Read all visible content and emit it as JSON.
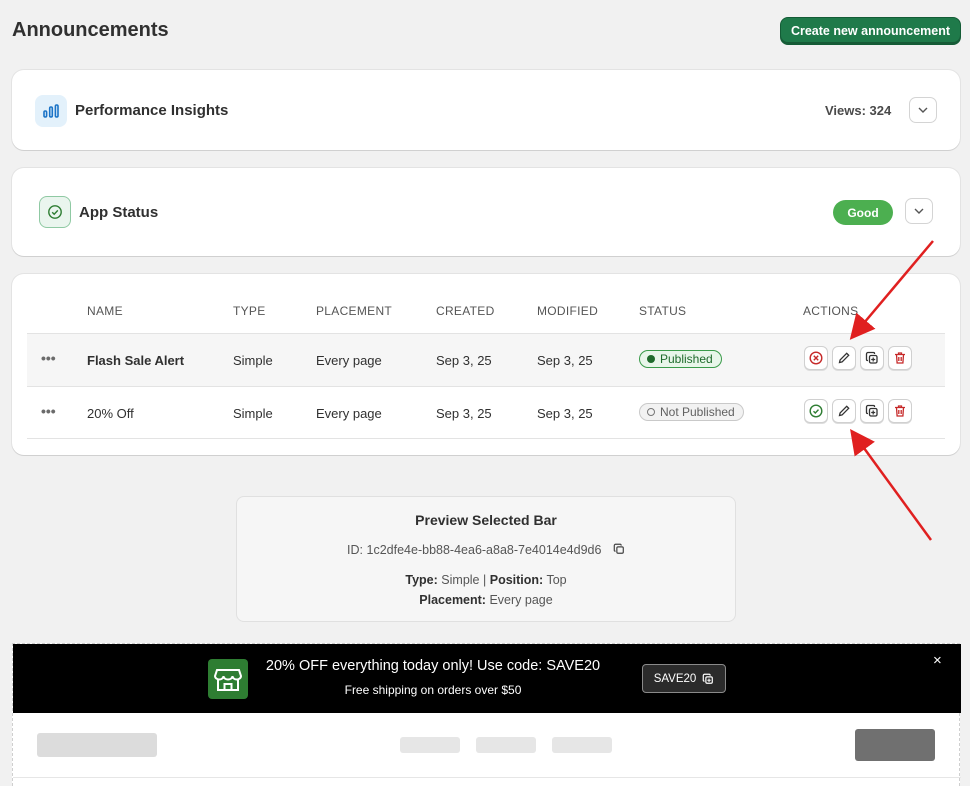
{
  "page": {
    "title": "Announcements",
    "create_label": "Create new announcement"
  },
  "performance": {
    "title": "Performance Insights",
    "views": "Views: 324"
  },
  "app_status": {
    "title": "App Status",
    "badge": "Good",
    "badge_color": "#4caf50"
  },
  "table": {
    "headers": [
      "NAME",
      "TYPE",
      "PLACEMENT",
      "CREATED",
      "MODIFIED",
      "STATUS",
      "ACTIONS"
    ],
    "rows": [
      {
        "name": "Flash Sale Alert",
        "type": "Simple",
        "placement": "Every page",
        "created": "Sep 3, 25",
        "modified": "Sep 3, 25",
        "status": "Published"
      },
      {
        "name": "20% Off",
        "type": "Simple",
        "placement": "Every page",
        "created": "Sep 3, 25",
        "modified": "Sep 3, 25",
        "status": "Not Published"
      }
    ]
  },
  "preview": {
    "title": "Preview Selected Bar",
    "id_label": "ID:",
    "id_value": "1c2dfe4e-bb88-4ea6-a8a8-7e4014e4d9d6",
    "type_label": "Type:",
    "type_value": "Simple",
    "separator": "|",
    "position_label": "Position:",
    "position_value": "Top",
    "placement_label": "Placement:",
    "placement_value": "Every page"
  },
  "announcement_bar": {
    "message": "20% OFF everything today only! Use code: SAVE20",
    "subtext": "Free shipping on orders over $50",
    "code": "SAVE20",
    "close": "×"
  },
  "colors": {
    "accent": "#1f7a4a",
    "published": "#3a9b4a",
    "delete": "#c62828"
  }
}
